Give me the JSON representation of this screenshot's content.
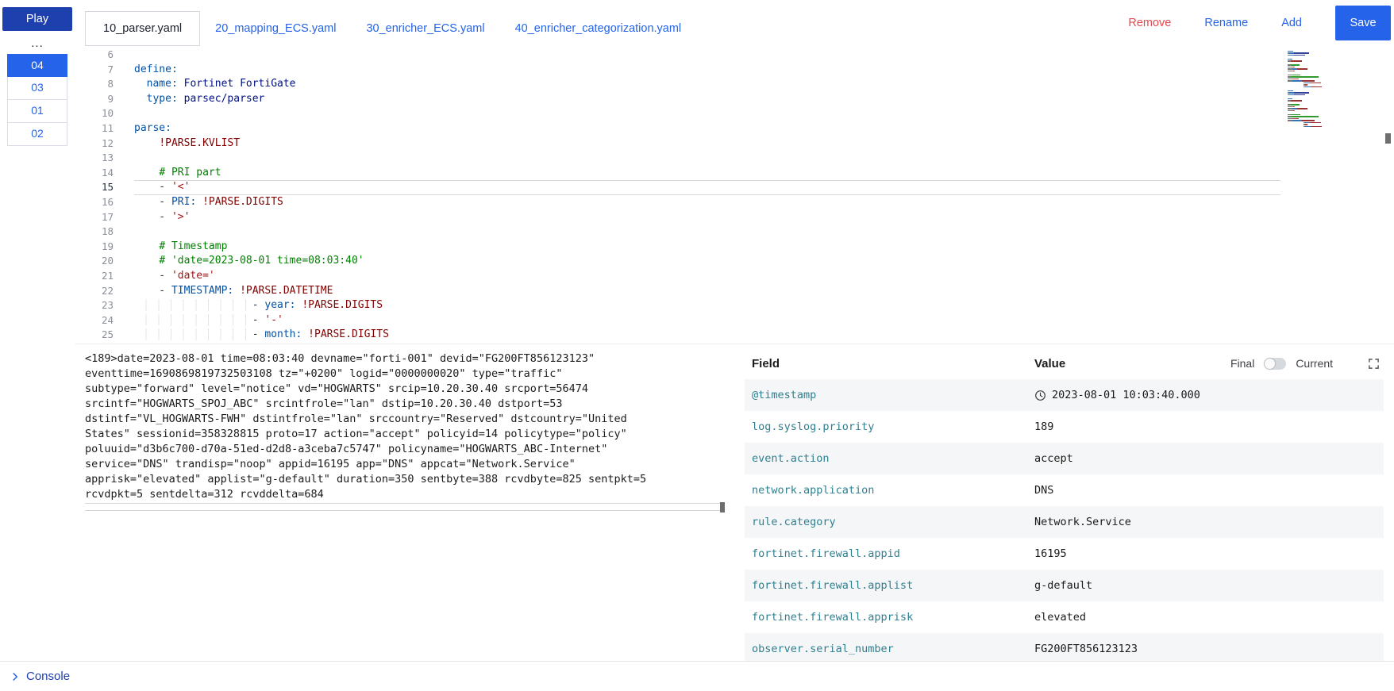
{
  "colors": {
    "accent": "#2563eb",
    "play": "#1e3fae",
    "danger": "#e5484d",
    "field": "#2e7f90",
    "c-key": "#0451a5",
    "c-val": "#001080",
    "c-str": "#a31515",
    "c-cmt": "#008000",
    "c-tag": "#800000"
  },
  "sidebar": {
    "play_label": "Play",
    "more_label": "...",
    "items": [
      {
        "label": "04",
        "selected": true
      },
      {
        "label": "03",
        "selected": false
      },
      {
        "label": "01",
        "selected": false
      },
      {
        "label": "02",
        "selected": false
      }
    ]
  },
  "tabs": {
    "items": [
      {
        "label": "10_parser.yaml",
        "active": true
      },
      {
        "label": "20_mapping_ECS.yaml",
        "active": false
      },
      {
        "label": "30_enricher_ECS.yaml",
        "active": false
      },
      {
        "label": "40_enricher_categorization.yaml",
        "active": false
      }
    ]
  },
  "actions": {
    "remove": "Remove",
    "rename": "Rename",
    "add": "Add",
    "save": "Save"
  },
  "editor": {
    "active_line": 15,
    "lines": [
      {
        "num": 6,
        "segments": []
      },
      {
        "num": 7,
        "segments": [
          {
            "t": "key",
            "x": "define:"
          }
        ]
      },
      {
        "num": 8,
        "segments": [
          {
            "t": "plain",
            "x": "  "
          },
          {
            "t": "key",
            "x": "name: "
          },
          {
            "t": "val",
            "x": "Fortinet FortiGate"
          }
        ]
      },
      {
        "num": 9,
        "segments": [
          {
            "t": "plain",
            "x": "  "
          },
          {
            "t": "key",
            "x": "type: "
          },
          {
            "t": "val",
            "x": "parsec/parser"
          }
        ]
      },
      {
        "num": 10,
        "segments": []
      },
      {
        "num": 11,
        "segments": [
          {
            "t": "key",
            "x": "parse:"
          }
        ]
      },
      {
        "num": 12,
        "segments": [
          {
            "t": "plain",
            "x": "    "
          },
          {
            "t": "tag",
            "x": "!PARSE.KVLIST"
          }
        ]
      },
      {
        "num": 13,
        "segments": []
      },
      {
        "num": 14,
        "segments": [
          {
            "t": "plain",
            "x": "    "
          },
          {
            "t": "cmt",
            "x": "# PRI part"
          }
        ]
      },
      {
        "num": 15,
        "segments": [
          {
            "t": "plain",
            "x": "    - "
          },
          {
            "t": "str",
            "x": "'<'"
          }
        ]
      },
      {
        "num": 16,
        "segments": [
          {
            "t": "plain",
            "x": "    - "
          },
          {
            "t": "key",
            "x": "PRI: "
          },
          {
            "t": "tag",
            "x": "!PARSE.DIGITS"
          }
        ]
      },
      {
        "num": 17,
        "segments": [
          {
            "t": "plain",
            "x": "    - "
          },
          {
            "t": "str",
            "x": "'>'"
          }
        ]
      },
      {
        "num": 18,
        "segments": []
      },
      {
        "num": 19,
        "segments": [
          {
            "t": "plain",
            "x": "    "
          },
          {
            "t": "cmt",
            "x": "# Timestamp"
          }
        ]
      },
      {
        "num": 20,
        "segments": [
          {
            "t": "plain",
            "x": "    "
          },
          {
            "t": "cmt",
            "x": "# 'date=2023-08-01 time=08:03:40'"
          }
        ]
      },
      {
        "num": 21,
        "segments": [
          {
            "t": "plain",
            "x": "    - "
          },
          {
            "t": "str",
            "x": "'date='"
          }
        ]
      },
      {
        "num": 22,
        "segments": [
          {
            "t": "plain",
            "x": "    - "
          },
          {
            "t": "key",
            "x": "TIMESTAMP: "
          },
          {
            "t": "tag",
            "x": "!PARSE.DATETIME"
          }
        ]
      },
      {
        "num": 23,
        "segments": [
          {
            "t": "indent",
            "x": "                   "
          },
          {
            "t": "plain",
            "x": "- "
          },
          {
            "t": "key",
            "x": "year: "
          },
          {
            "t": "tag",
            "x": "!PARSE.DIGITS"
          }
        ]
      },
      {
        "num": 24,
        "segments": [
          {
            "t": "indent",
            "x": "                   "
          },
          {
            "t": "plain",
            "x": "- "
          },
          {
            "t": "str",
            "x": "'-'"
          }
        ]
      },
      {
        "num": 25,
        "segments": [
          {
            "t": "indent",
            "x": "                   "
          },
          {
            "t": "plain",
            "x": "- "
          },
          {
            "t": "key",
            "x": "month: "
          },
          {
            "t": "tag",
            "x": "!PARSE.DIGITS"
          }
        ]
      }
    ]
  },
  "event_input": {
    "text": "<189>date=2023-08-01 time=08:03:40 devname=\"forti-001\" devid=\"FG200FT856123123\" eventtime=1690869819732503108 tz=\"+0200\" logid=\"0000000020\" type=\"traffic\" subtype=\"forward\" level=\"notice\" vd=\"HOGWARTS\" srcip=10.20.30.40 srcport=56474 srcintf=\"HOGWARTS_SPOJ_ABC\" srcintfrole=\"lan\" dstip=10.20.30.40 dstport=53 dstintf=\"VL_HOGWARTS-FWH\" dstintfrole=\"lan\" srccountry=\"Reserved\" dstcountry=\"United States\" sessionid=358328815 proto=17 action=\"accept\" policyid=14 policytype=\"policy\" poluuid=\"d3b6c700-d70a-51ed-d2d8-a3ceba7c5747\" policyname=\"HOGWARTS_ABC-Internet\" service=\"DNS\" trandisp=\"noop\" appid=16195 app=\"DNS\" appcat=\"Network.Service\" apprisk=\"elevated\" applist=\"g-default\" duration=350 sentbyte=388 rcvdbyte=825 sentpkt=5 rcvdpkt=5 sentdelta=312 rcvddelta=684"
  },
  "fields_table": {
    "field_header": "Field",
    "value_header": "Value",
    "final_label": "Final",
    "current_label": "Current",
    "rows": [
      {
        "field": "@timestamp",
        "value": "2023-08-01 10:03:40.000",
        "icon": "clock"
      },
      {
        "field": "log.syslog.priority",
        "value": "189"
      },
      {
        "field": "event.action",
        "value": "accept"
      },
      {
        "field": "network.application",
        "value": "DNS"
      },
      {
        "field": "rule.category",
        "value": "Network.Service"
      },
      {
        "field": "fortinet.firewall.appid",
        "value": "16195"
      },
      {
        "field": "fortinet.firewall.applist",
        "value": "g-default"
      },
      {
        "field": "fortinet.firewall.apprisk",
        "value": "elevated"
      },
      {
        "field": "observer.serial_number",
        "value": "FG200FT856123123"
      }
    ]
  },
  "console": {
    "label": "Console"
  }
}
